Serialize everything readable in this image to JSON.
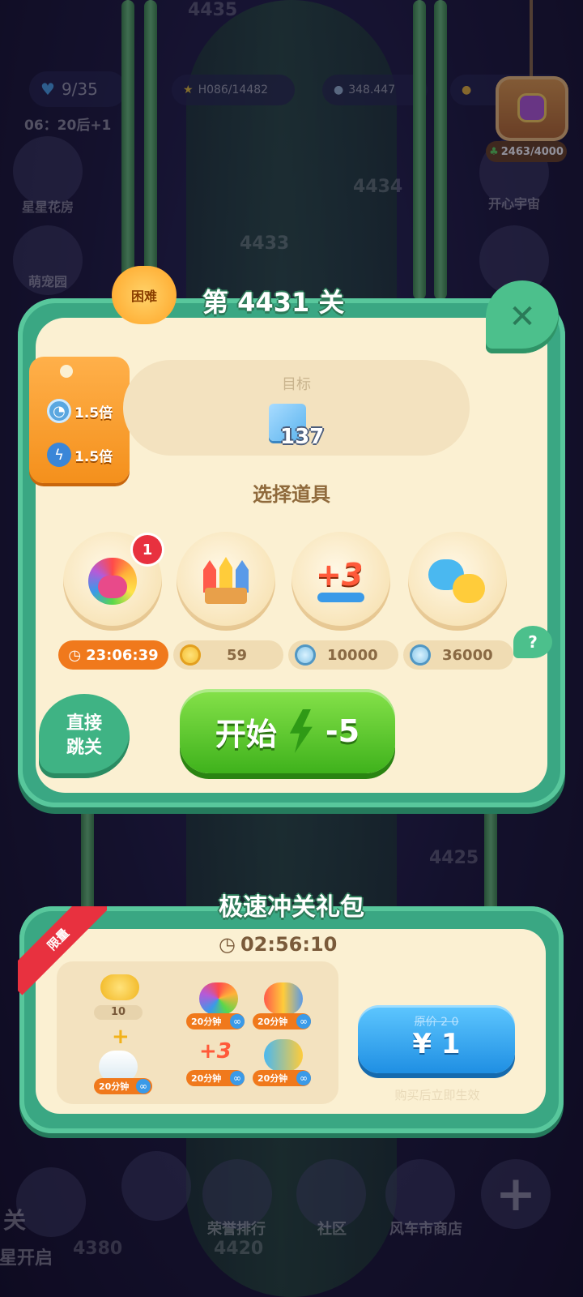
{
  "background": {
    "level_numbers": [
      "4435",
      "4434",
      "4433",
      "4425",
      "4420",
      "4380"
    ],
    "hud": {
      "lives": "9/35",
      "lives_timer": "06：20后+1",
      "stars": "H086/14482",
      "coins": "348.447"
    },
    "side_left": [
      "星星花房",
      "萌宠园"
    ],
    "side_right": [
      "开心宇宙"
    ],
    "chest_progress": "2463/4000",
    "bottom_nav": [
      "荣誉排行",
      "社区",
      "风车市商店"
    ],
    "partial_text": [
      "关",
      "星开启"
    ]
  },
  "dialog": {
    "difficulty": "困难",
    "title": "第 4431 关",
    "close_icon": "close-icon",
    "boosts": [
      {
        "icon": "coin-clock-icon",
        "label": "1.5倍"
      },
      {
        "icon": "energy-icon",
        "label": "1.5倍"
      }
    ],
    "goal": {
      "label": "目标",
      "block_color": "#6fc1f2",
      "count": "137"
    },
    "section_title": "选择道具",
    "props": [
      {
        "icon": "rainbow-bird-icon",
        "badge": "1",
        "price_label": "23:06:39",
        "price_type": "timer"
      },
      {
        "icon": "rockets-icon",
        "price_label": "59",
        "price_type": "gold"
      },
      {
        "icon": "plus-three-moves-icon",
        "price_label": "10000",
        "price_type": "silver"
      },
      {
        "icon": "pets-icon",
        "price_label": "36000",
        "price_type": "silver"
      }
    ],
    "help": "?",
    "skip_button": [
      "直接",
      "跳关"
    ],
    "start_button": {
      "label": "开始",
      "cost": "-5"
    }
  },
  "gift_pack": {
    "tag": "限量",
    "title": "极速冲关礼包",
    "timer": "02:56:10",
    "items": [
      {
        "name": "gold-coins",
        "label": "10"
      },
      {
        "name": "rainbow-bird",
        "label": "20分钟"
      },
      {
        "name": "rockets",
        "label": "20分钟"
      },
      {
        "name": "bottle",
        "label": "20分钟"
      },
      {
        "name": "plus-three",
        "label": "20分钟"
      },
      {
        "name": "pets",
        "label": "20分钟"
      }
    ],
    "infinite": "∞",
    "plus": "+",
    "original_price": "原价 2 0",
    "price": "¥ 1",
    "note": "购买后立即生效"
  },
  "colors": {
    "accent_green": "#3aa783",
    "start_green": "#3fb21c",
    "buy_blue": "#1f8fe3",
    "panel_cream": "#fbf0d2"
  }
}
